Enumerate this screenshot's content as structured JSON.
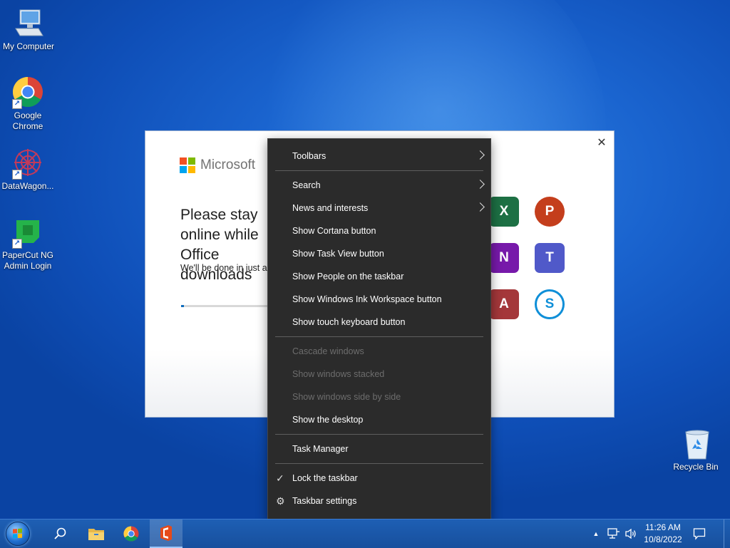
{
  "desktop": {
    "icons": [
      {
        "label": "My Computer"
      },
      {
        "label": "Google Chrome"
      },
      {
        "label": "DataWagon..."
      },
      {
        "label": "PaperCut NG Admin Login"
      }
    ],
    "recycle_bin_label": "Recycle Bin"
  },
  "installer": {
    "brand": "Microsoft",
    "title": "Please stay online while Office downloads",
    "subtitle": "We'll be done in just a moment.",
    "progress_fraction": 0.03,
    "apps": [
      {
        "name": "excel-icon",
        "letter": "X",
        "color": "#1d7044"
      },
      {
        "name": "powerpoint-icon",
        "letter": "P",
        "color": "#c43e1c"
      },
      {
        "name": "onenote-icon",
        "letter": "N",
        "color": "#7719aa"
      },
      {
        "name": "teams-icon",
        "letter": "T",
        "color": "#5059c9"
      },
      {
        "name": "access-icon",
        "letter": "A",
        "color": "#a4373a"
      },
      {
        "name": "skype-icon",
        "letter": "S",
        "color": "#0f8fd8"
      }
    ]
  },
  "context_menu": {
    "items": [
      {
        "label": "Toolbars",
        "submenu": true
      },
      {
        "label": "Search",
        "submenu": true
      },
      {
        "label": "News and interests",
        "submenu": true
      },
      {
        "label": "Show Cortana button"
      },
      {
        "label": "Show Task View button"
      },
      {
        "label": "Show People on the taskbar"
      },
      {
        "label": "Show Windows Ink Workspace button"
      },
      {
        "label": "Show touch keyboard button"
      },
      {
        "label": "Cascade windows",
        "disabled": true
      },
      {
        "label": "Show windows stacked",
        "disabled": true
      },
      {
        "label": "Show windows side by side",
        "disabled": true
      },
      {
        "label": "Show the desktop"
      },
      {
        "label": "Task Manager"
      },
      {
        "label": "Lock the taskbar",
        "checked": true
      },
      {
        "label": "Taskbar settings",
        "icon": "gear-icon"
      }
    ]
  },
  "taskbar": {
    "time": "11:26 AM",
    "date": "10/8/2022",
    "pinned": [
      "start-button",
      "search-button",
      "file-explorer-button",
      "chrome-button",
      "office-button"
    ],
    "active": "office-button"
  },
  "colors": {
    "menu_bg": "#2b2b2b",
    "taskbar": "#1e5fb4",
    "accent": "#0f6cbd"
  }
}
